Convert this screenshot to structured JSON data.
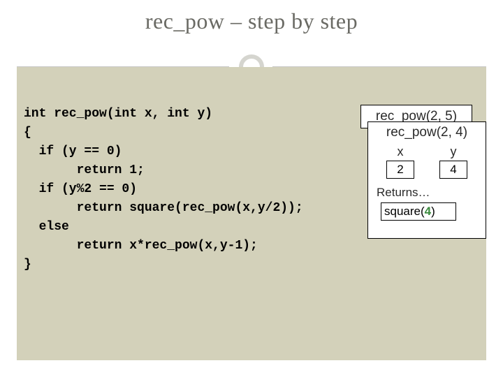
{
  "title": "rec_pow – step by step",
  "code": {
    "l1": "int rec_pow(int x, int y)",
    "l2": "{",
    "l3": "  if (y == 0)",
    "l4": "       return 1;",
    "l5": "  if (y%2 == 0)",
    "l6": "       return square(rec_pow(x,y/2));",
    "l7": "  else",
    "l8": "       return x*rec_pow(x,y-1);",
    "l9": "}"
  },
  "stack": {
    "back_frame": "rec_pow(2, 5)",
    "front_frame": {
      "title": "rec_pow(2, 4)",
      "vars": [
        {
          "name": "x",
          "value": "2"
        },
        {
          "name": "y",
          "value": "4"
        }
      ],
      "returns_label": "Returns…",
      "return_expr_prefix": "square(",
      "return_expr_value": "4",
      "return_expr_suffix": ")"
    }
  }
}
